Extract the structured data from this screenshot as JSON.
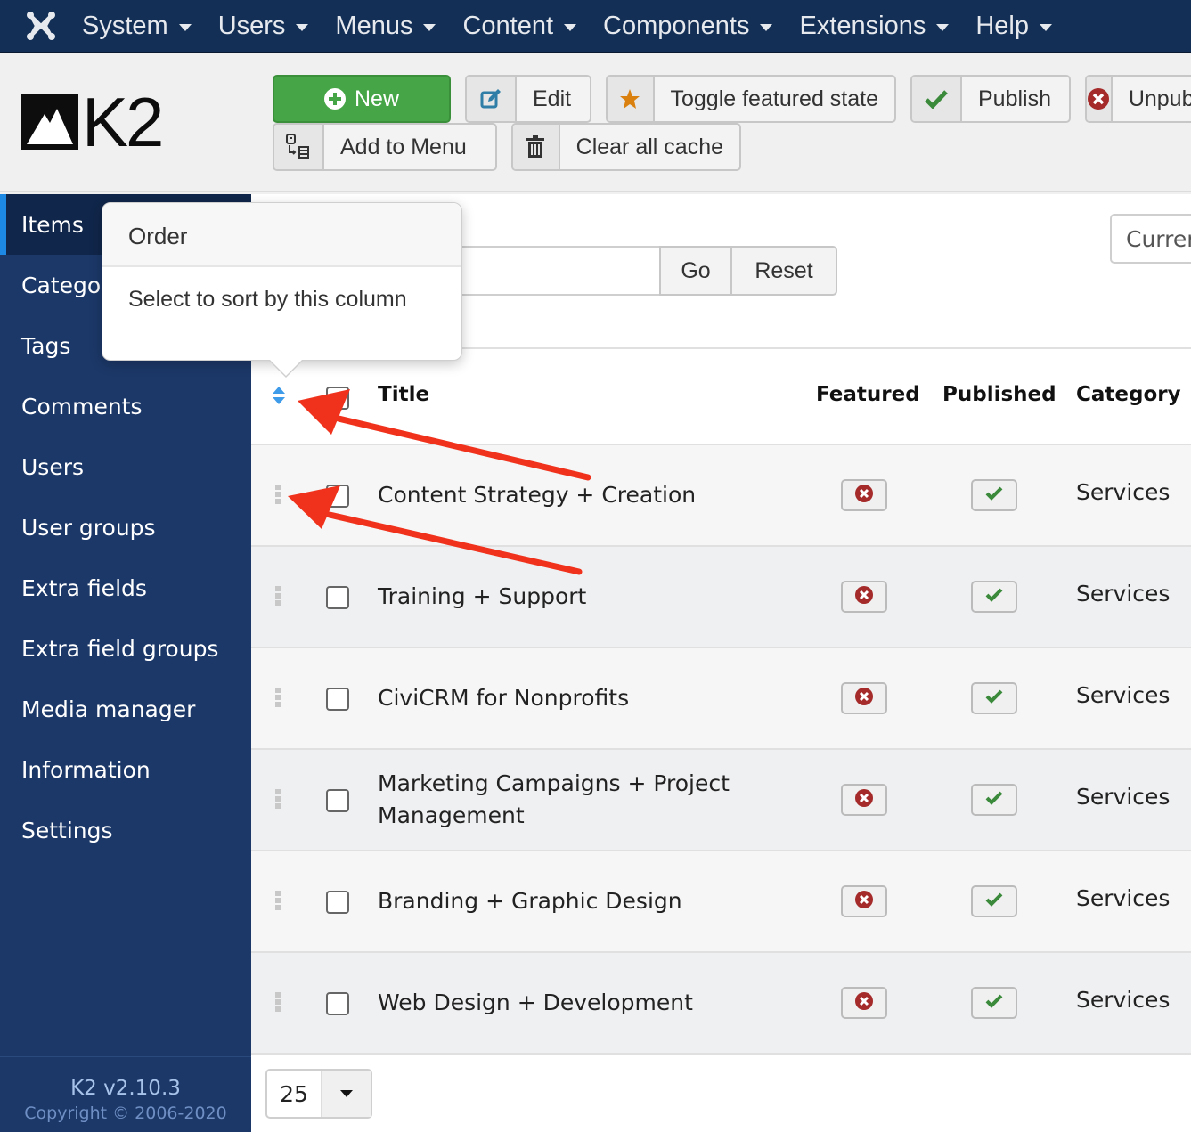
{
  "topnav": {
    "logo_icon": "joomla-logo-icon",
    "items": [
      {
        "label": "System"
      },
      {
        "label": "Users"
      },
      {
        "label": "Menus"
      },
      {
        "label": "Content"
      },
      {
        "label": "Components"
      },
      {
        "label": "Extensions"
      },
      {
        "label": "Help"
      }
    ]
  },
  "header": {
    "logo_text": "K2",
    "toolbar": {
      "new_label": "New",
      "edit_label": "Edit",
      "toggle_featured_label": "Toggle featured state",
      "publish_label": "Publish",
      "unpublish_label": "Unpublish",
      "add_to_menu_label": "Add to Menu",
      "clear_cache_label": "Clear all cache"
    }
  },
  "sidebar": {
    "items": [
      {
        "label": "Items",
        "active": true
      },
      {
        "label": "Categories"
      },
      {
        "label": "Tags"
      },
      {
        "label": "Comments"
      },
      {
        "label": "Users"
      },
      {
        "label": "User groups"
      },
      {
        "label": "Extra fields"
      },
      {
        "label": "Extra field groups"
      },
      {
        "label": "Media manager"
      },
      {
        "label": "Information"
      },
      {
        "label": "Settings"
      }
    ],
    "version": "K2 v2.10.3",
    "copyright": "Copyright © 2006-2020"
  },
  "filters": {
    "search_value": "",
    "go_label": "Go",
    "reset_label": "Reset",
    "current_select_label": "Current"
  },
  "table": {
    "columns": {
      "title": "Title",
      "featured": "Featured",
      "published": "Published",
      "category": "Category"
    },
    "rows": [
      {
        "title": "Content Strategy + Creation",
        "featured": false,
        "published": true,
        "category": "Services"
      },
      {
        "title": "Training + Support",
        "featured": false,
        "published": true,
        "category": "Services"
      },
      {
        "title": "CiviCRM for Nonprofits",
        "featured": false,
        "published": true,
        "category": "Services"
      },
      {
        "title": "Marketing Campaigns + Project Management",
        "featured": false,
        "published": true,
        "category": "Services"
      },
      {
        "title": "Branding + Graphic Design",
        "featured": false,
        "published": true,
        "category": "Services"
      },
      {
        "title": "Web Design + Development",
        "featured": false,
        "published": true,
        "category": "Services"
      }
    ]
  },
  "pagination": {
    "limit_value": "25"
  },
  "tooltip": {
    "title": "Order",
    "body": "Select to sort by this column"
  },
  "colors": {
    "topnav_bg": "#132f55",
    "sidebar_bg": "#1c3868",
    "new_button": "#46a546",
    "publish_check": "#3b8a3b",
    "unpublish_x": "#a52a2a",
    "featured_star": "#d9800f",
    "sort_icon": "#3d9be9",
    "annotation_arrow": "#f0321c"
  }
}
